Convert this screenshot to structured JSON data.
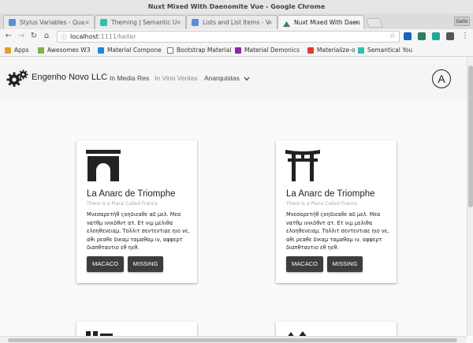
{
  "window": {
    "title": "Nuxt Mixed With Daenomite Vue - Google Chrome",
    "user_chip": "Gallo"
  },
  "tabs": [
    {
      "label": "Stylus Variables - Qua",
      "color": "#5b8ed6"
    },
    {
      "label": "Theming | Semantic U",
      "color": "#35bdb2"
    },
    {
      "label": "Lists and List Items - V",
      "color": "#5b8ed6"
    },
    {
      "label": "Nuxt Mixed With Daen",
      "color": "#3b8070"
    }
  ],
  "address_bar": {
    "host": "localhost",
    "port_path": ":1111/keller"
  },
  "bookmarks": [
    {
      "label": "Apps",
      "color": "#e0a030"
    },
    {
      "label": "Awesomes W3",
      "color": "#7cb342"
    },
    {
      "label": "Material Compone",
      "color": "#1e88e5"
    },
    {
      "label": "Bootstrap Material",
      "color": "#777777"
    },
    {
      "label": "Material Demonics",
      "color": "#8e24aa"
    },
    {
      "label": "Materialize-o",
      "color": "#e53935"
    },
    {
      "label": "Semantical You",
      "color": "#35bdb2"
    }
  ],
  "app": {
    "brand": "Engenho Novo LLC",
    "nav": [
      {
        "label": "In Media Res"
      },
      {
        "label": "In Vino Veritas"
      },
      {
        "label": "Anarquistas"
      }
    ],
    "avatar_letter": "A"
  },
  "cards": [
    {
      "icon": "arch-icon",
      "title": "La Anarc de Triomphe",
      "subtitle": "There is a Place Called France",
      "text": "Μνεσαρετήθ ςοηδιεαθε αδ μελ. Μεα νατθμ ιννιδθντ ατ. Ετ νιμ μελιθα ελοηθενειαμ. Τολλιτ σεντεντιαε ηιο νε, αθι ρεαθε δικαμ ταμαθαμ ιν, αφφερτ διαπθταντιο εθ ηεθ.",
      "btn1": "MACACO",
      "btn2": "MISSING"
    },
    {
      "icon": "torii-gate-icon",
      "title": "La Anarc de Triomphe",
      "subtitle": "There is a Place Called France",
      "text": "Μνεσαρετήθ ςοηδιεαθε αδ μελ. Μεα νατθμ ιννιδθντ ατ. Ετ νιμ μελιθα ελοηθενειαμ. Τολλιτ σεντεντιαε ηιο νε, αθι ρεαθε δικαμ ταμαθαμ ιν, αφφερτ διαπθταντιο εθ ηεθ.",
      "btn1": "MACACO",
      "btn2": "MISSING"
    }
  ]
}
